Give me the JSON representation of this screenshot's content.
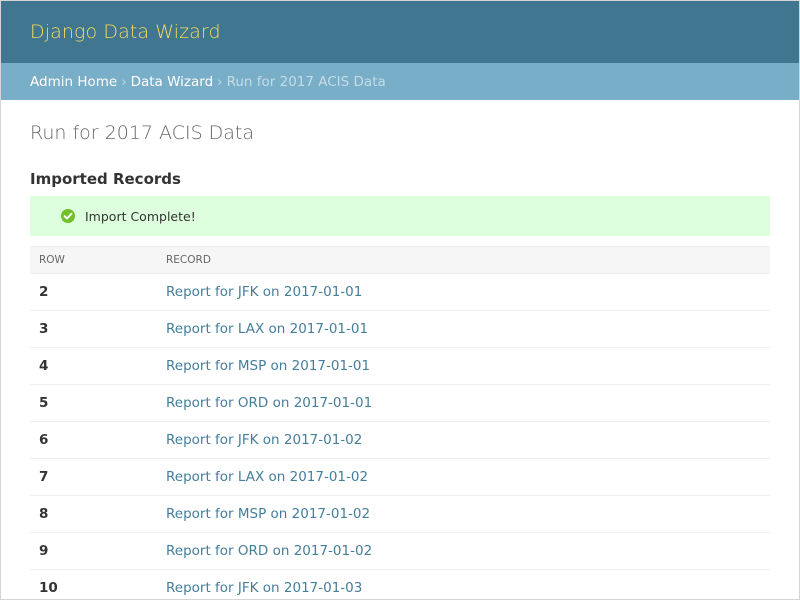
{
  "header": {
    "site_name": "Django Data Wizard"
  },
  "breadcrumbs": {
    "items": [
      "Admin Home",
      "Data Wizard"
    ],
    "separator": "›",
    "current": "Run for 2017 ACIS Data"
  },
  "main": {
    "title": "Run for 2017 ACIS Data",
    "section_title": "Imported Records",
    "message": {
      "text": "Import Complete!",
      "icon": "check-circle-icon",
      "icon_color": "#70bf2b",
      "background": "#ddffdd"
    },
    "table": {
      "columns": [
        "ROW",
        "RECORD"
      ],
      "rows": [
        {
          "row": "2",
          "record": "Report for JFK on 2017-01-01"
        },
        {
          "row": "3",
          "record": "Report for LAX on 2017-01-01"
        },
        {
          "row": "4",
          "record": "Report for MSP on 2017-01-01"
        },
        {
          "row": "5",
          "record": "Report for ORD on 2017-01-01"
        },
        {
          "row": "6",
          "record": "Report for JFK on 2017-01-02"
        },
        {
          "row": "7",
          "record": "Report for LAX on 2017-01-02"
        },
        {
          "row": "8",
          "record": "Report for MSP on 2017-01-02"
        },
        {
          "row": "9",
          "record": "Report for ORD on 2017-01-02"
        },
        {
          "row": "10",
          "record": "Report for JFK on 2017-01-03"
        }
      ]
    }
  },
  "colors": {
    "header_bg": "#417690",
    "site_name": "#f5dd5d",
    "breadcrumbs_bg": "#79aec8",
    "link": "#447e9b"
  }
}
